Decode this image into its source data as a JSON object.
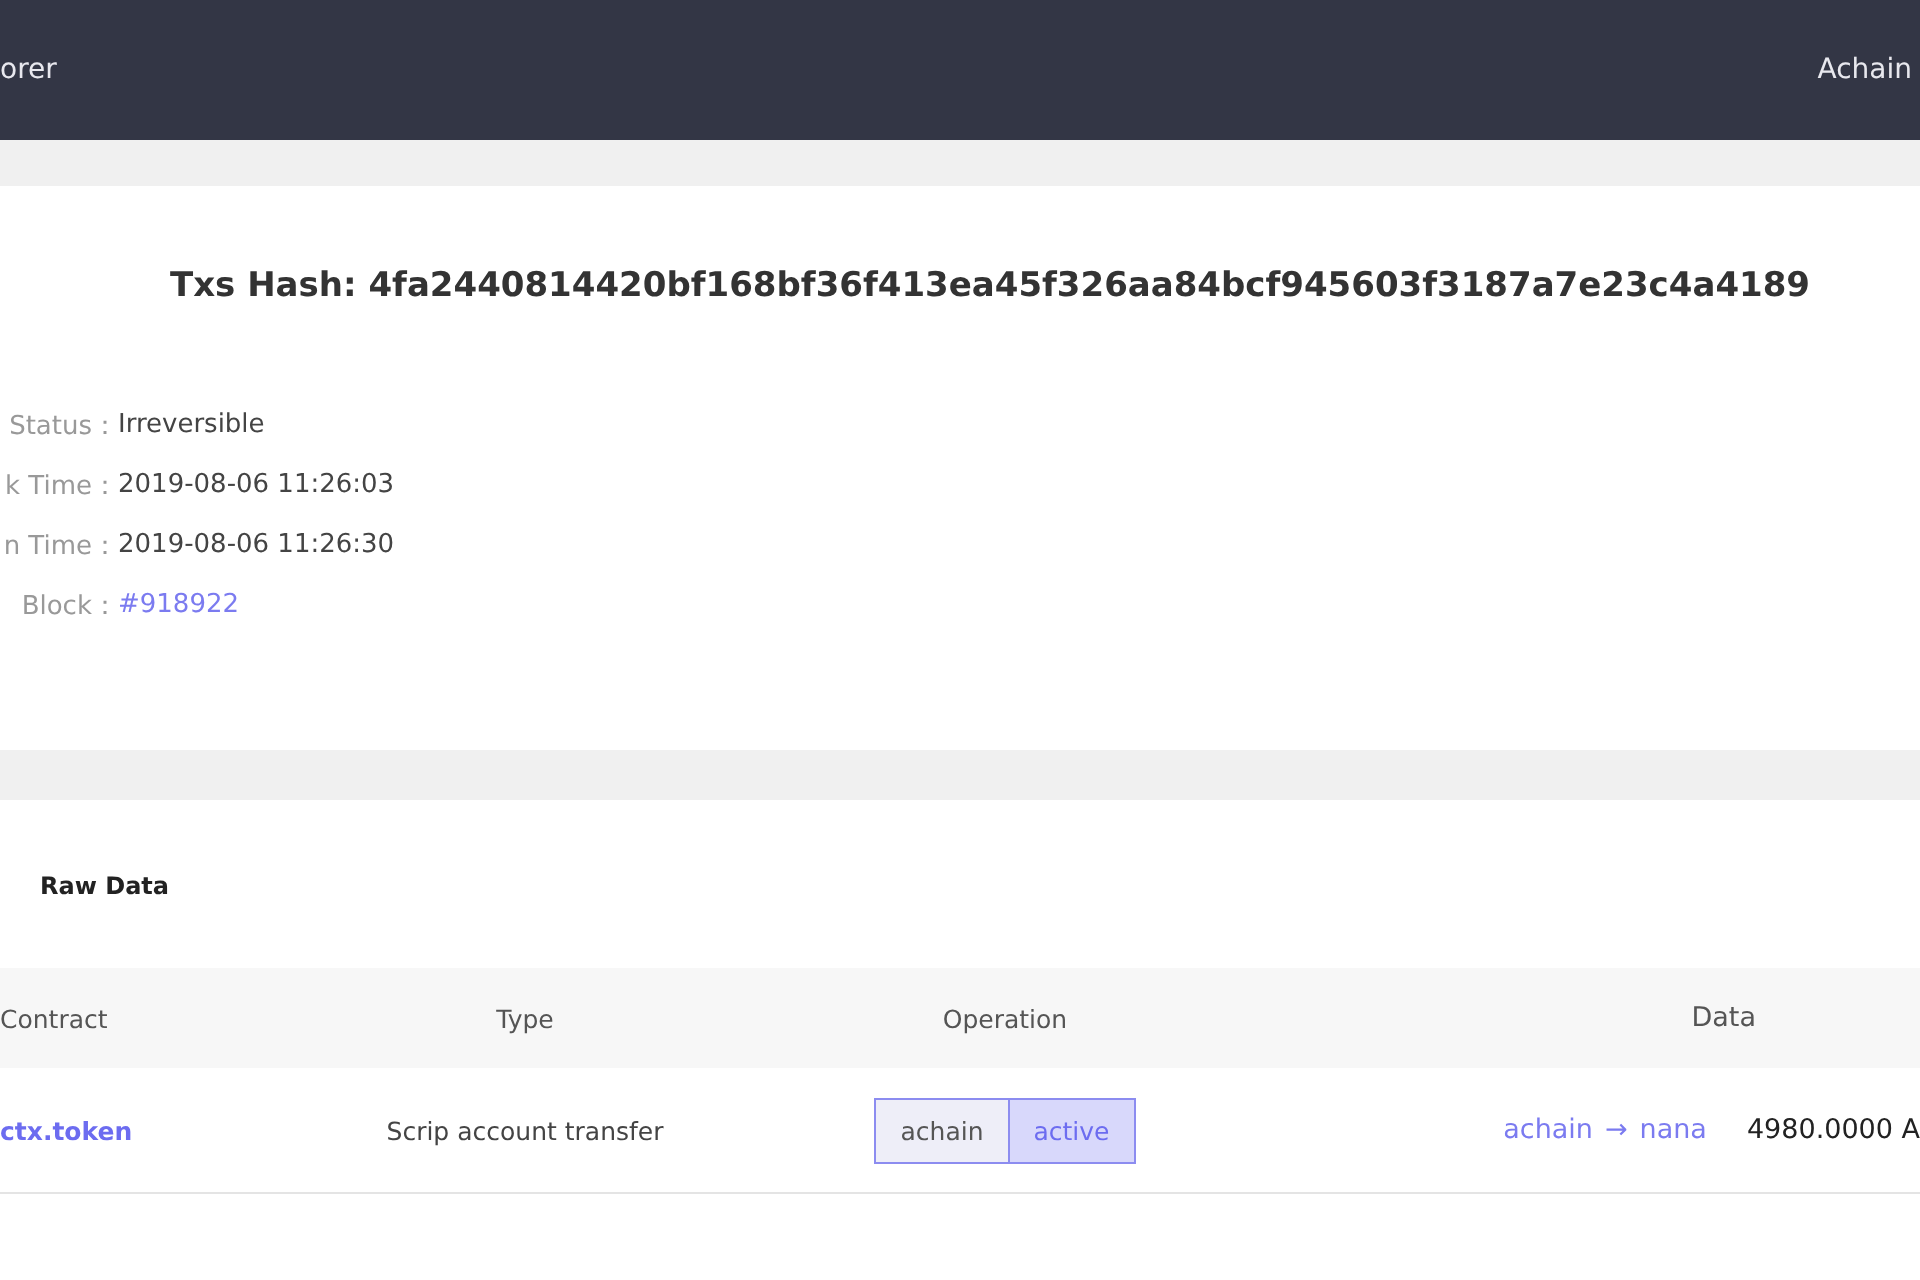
{
  "header": {
    "title": "orer",
    "account": "Achain"
  },
  "transaction": {
    "hash_label": "Txs Hash: 4fa2440814420bf168bf36f413ea45f326aa84bcf945603f3187a7e23c4a4189",
    "fields": [
      {
        "label": "Status：",
        "value": "Irreversible",
        "kind": "text"
      },
      {
        "label": "k Time：",
        "value": "2019-08-06 11:26:03",
        "kind": "text"
      },
      {
        "label": "n Time：",
        "value": "2019-08-06 11:26:30",
        "kind": "text"
      },
      {
        "label": "Block：",
        "value": "#918922",
        "kind": "link"
      }
    ]
  },
  "raw_data": {
    "title": "Raw Data",
    "table": {
      "columns": [
        "Contract",
        "Type",
        "Operation",
        "Data"
      ],
      "rows": [
        {
          "contract": "ctx.token",
          "type": "Scrip account transfer",
          "operation": [
            "achain",
            "active"
          ],
          "from": "achain",
          "arrow": "→",
          "to": "nana",
          "amount": "4980.0000 A"
        }
      ]
    }
  }
}
